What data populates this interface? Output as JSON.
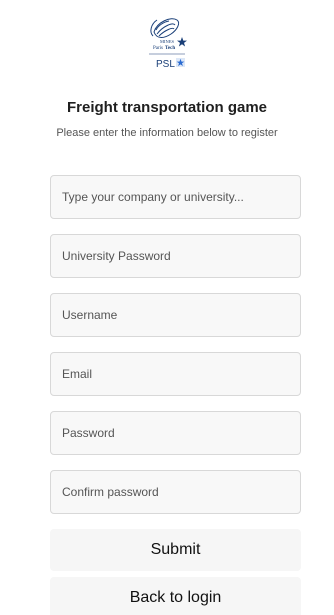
{
  "logo": {
    "mines_line": "MINES",
    "paris_line": "Paris",
    "tech_line": "Tech",
    "psl_text": "PSL",
    "brand_color": "#1a3f78",
    "star_color": "#2a6bd1"
  },
  "header": {
    "title": "Freight transportation game",
    "subtitle": "Please enter the information below to register"
  },
  "form": {
    "company_placeholder": "Type your company or university...",
    "university_password_placeholder": "University Password",
    "username_placeholder": "Username",
    "email_placeholder": "Email",
    "password_placeholder": "Password",
    "confirm_password_placeholder": "Confirm password"
  },
  "buttons": {
    "submit_label": "Submit",
    "back_label": "Back to login"
  }
}
